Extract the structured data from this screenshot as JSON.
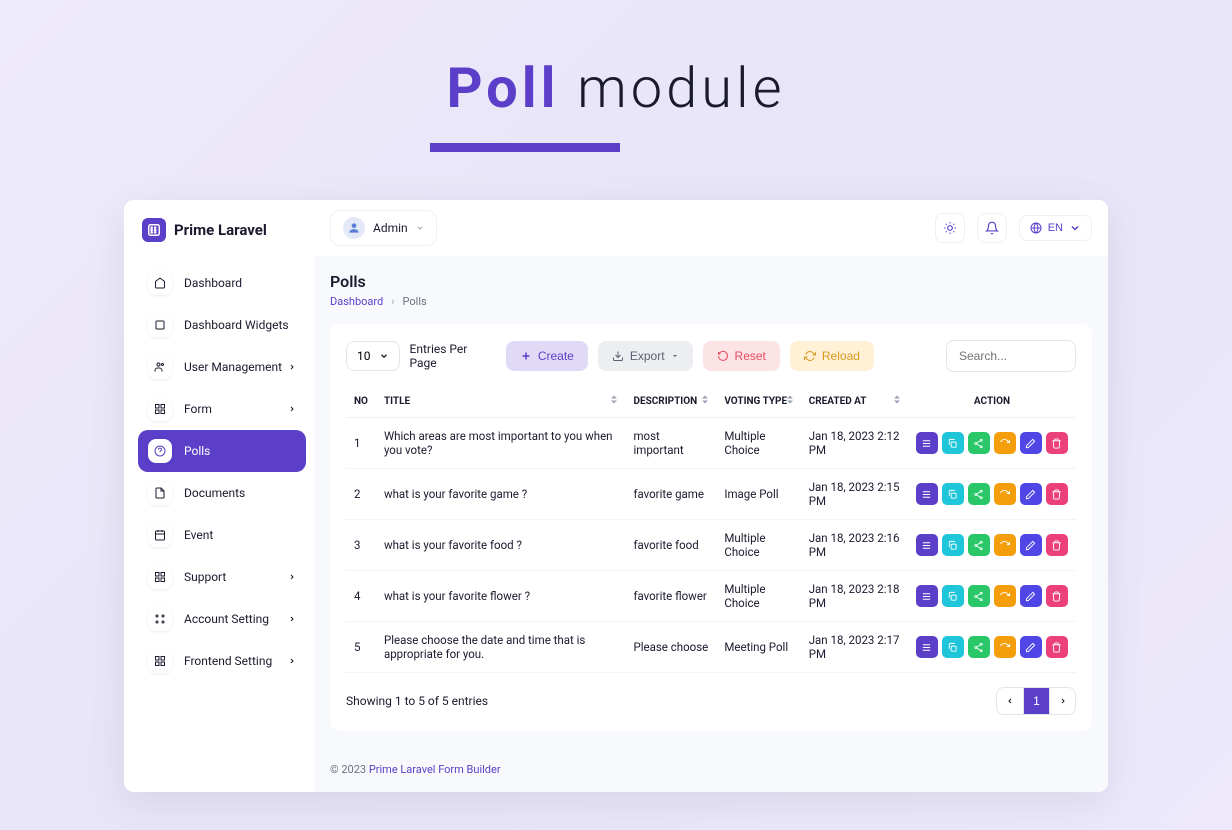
{
  "page_title": {
    "accent": "Poll",
    "rest": " module"
  },
  "logo": {
    "text": "Prime Laravel"
  },
  "user": {
    "name": "Admin"
  },
  "lang": "EN",
  "sidebar": {
    "items": [
      {
        "label": "Dashboard",
        "icon": "home",
        "chevron": false
      },
      {
        "label": "Dashboard Widgets",
        "icon": "square",
        "chevron": false
      },
      {
        "label": "User Management",
        "icon": "users",
        "chevron": true
      },
      {
        "label": "Form",
        "icon": "grid",
        "chevron": true
      },
      {
        "label": "Polls",
        "icon": "circle-help",
        "chevron": false,
        "active": true
      },
      {
        "label": "Documents",
        "icon": "file",
        "chevron": false
      },
      {
        "label": "Event",
        "icon": "calendar",
        "chevron": false
      },
      {
        "label": "Support",
        "icon": "grid",
        "chevron": true
      },
      {
        "label": "Account Setting",
        "icon": "settings",
        "chevron": true
      },
      {
        "label": "Frontend Setting",
        "icon": "grid",
        "chevron": true
      }
    ]
  },
  "heading": "Polls",
  "breadcrumb": {
    "link": "Dashboard",
    "current": "Polls"
  },
  "toolbar": {
    "entries_value": "10",
    "entries_label": "Entries Per Page",
    "create": "Create",
    "export": "Export",
    "reset": "Reset",
    "reload": "Reload",
    "search_placeholder": "Search..."
  },
  "table": {
    "headers": {
      "no": "NO",
      "title": "TITLE",
      "description": "DESCRIPTION",
      "voting_type": "VOTING TYPE",
      "created_at": "CREATED AT",
      "action": "ACTION"
    },
    "rows": [
      {
        "no": "1",
        "title": "Which areas are most important to you when you vote?",
        "description": "most important",
        "voting_type": "Multiple Choice",
        "created_at": "Jan 18, 2023 2:12 PM"
      },
      {
        "no": "2",
        "title": "what is your favorite game ?",
        "description": "favorite game",
        "voting_type": "Image Poll",
        "created_at": "Jan 18, 2023 2:15 PM"
      },
      {
        "no": "3",
        "title": "what is your favorite food ?",
        "description": "favorite food",
        "voting_type": "Multiple Choice",
        "created_at": "Jan 18, 2023 2:16 PM"
      },
      {
        "no": "4",
        "title": "what is your favorite flower ?",
        "description": "favorite flower",
        "voting_type": "Multiple Choice",
        "created_at": "Jan 18, 2023 2:18 PM"
      },
      {
        "no": "5",
        "title": "Please choose the date and time that is appropriate for you.",
        "description": "Please choose",
        "voting_type": "Meeting Poll",
        "created_at": "Jan 18, 2023 2:17 PM"
      }
    ],
    "showing": "Showing 1 to 5 of 5 entries",
    "page": "1"
  },
  "footer": {
    "copyright": "© 2023 ",
    "link": "Prime Laravel Form Builder"
  }
}
